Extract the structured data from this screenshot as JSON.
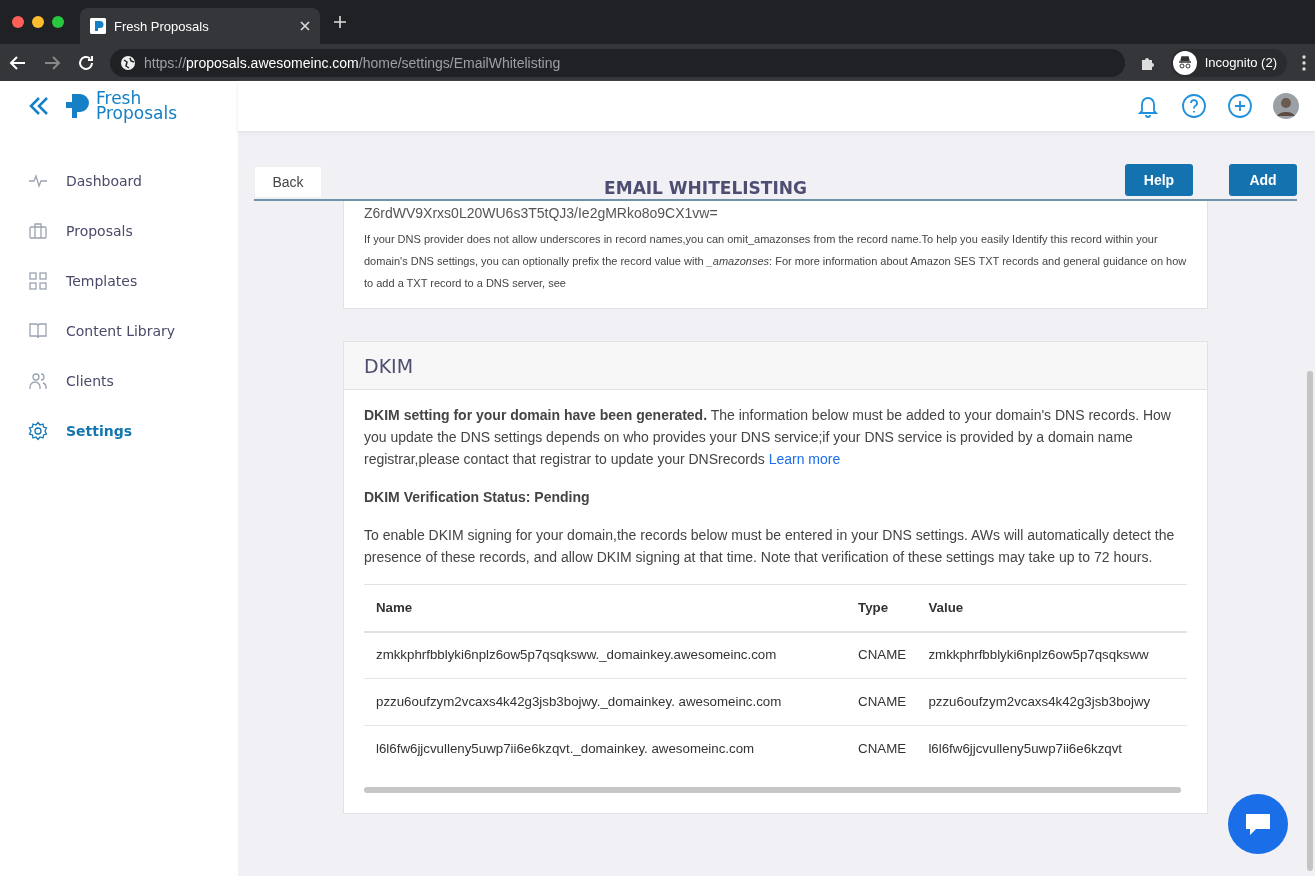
{
  "browser": {
    "tab_title": "Fresh Proposals",
    "url_host": "proposals.awesomeinc.com",
    "url_scheme": "https://",
    "url_path": "/home/settings/EmailWhitelisting",
    "profile": "Incognito (2)"
  },
  "app": {
    "logo_line1": "Fresh",
    "logo_line2": "Proposals"
  },
  "sidebar": {
    "items": [
      {
        "label": "Dashboard",
        "selected": false
      },
      {
        "label": "Proposals",
        "selected": false
      },
      {
        "label": "Templates",
        "selected": false
      },
      {
        "label": "Content Library",
        "selected": false
      },
      {
        "label": "Clients",
        "selected": false
      },
      {
        "label": "Settings",
        "selected": true
      }
    ]
  },
  "page": {
    "back": "Back",
    "title": "EMAIL WHITELISTING",
    "help": "Help",
    "add": "Add"
  },
  "txt_card": {
    "record_value": "Z6rdWV9Xrxs0L20WU6s3T5tQJ3/Ie2gMRko8o9CX1vw=",
    "note": "If your DNS provider does not allow underscores in record names,you can omit_amazonses from the record name.To help you easily Identify this record within your domain's DNS settings, you can optionally prefix the record value with *_amazonses*: For more information about Amazon SES TXT records and general guidance on how to add a TXT record to a DNS server, see"
  },
  "dkim": {
    "title": "DKIM",
    "intro": "**DKIM setting for your domain have been generated.** The information below must be added to your domain's DNS records. How you update the DNS settings depends on who provides your DNS service;if your DNS service is provided by a domain name registrar,please contact that registrar to update your DNSrecords",
    "learn_more": "Learn more",
    "status": "DKIM Verification Status: Pending",
    "instructions": "To enable DKIM signing for your domain,the records below must be entered in your DNS settings. AWs will automatically detect the presence of these records, and allow DKIM signing at that time. Note that verification of these settings may take up to 72 hours.",
    "table": {
      "columns": [
        "Name",
        "Type",
        "Value"
      ],
      "rows": [
        [
          "zmkkphrfbblyki6nplz6ow5p7qsqksww._domainkey.awesomeinc.com",
          "CNAME",
          "zmkkphrfbblyki6nplz6ow5p7qsqksww"
        ],
        [
          "pzzu6oufzym2vcaxs4k42g3jsb3bojwy._domainkey. awesomeinc.com",
          "CNAME",
          "pzzu6oufzym2vcaxs4k42g3jsb3bojwy"
        ],
        [
          "l6l6fw6jjcvulleny5uwp7ii6e6kzqvt._domainkey. awesomeinc.com",
          "CNAME",
          "l6l6fw6jjcvulleny5uwp7ii6e6kzqvt"
        ]
      ]
    }
  }
}
